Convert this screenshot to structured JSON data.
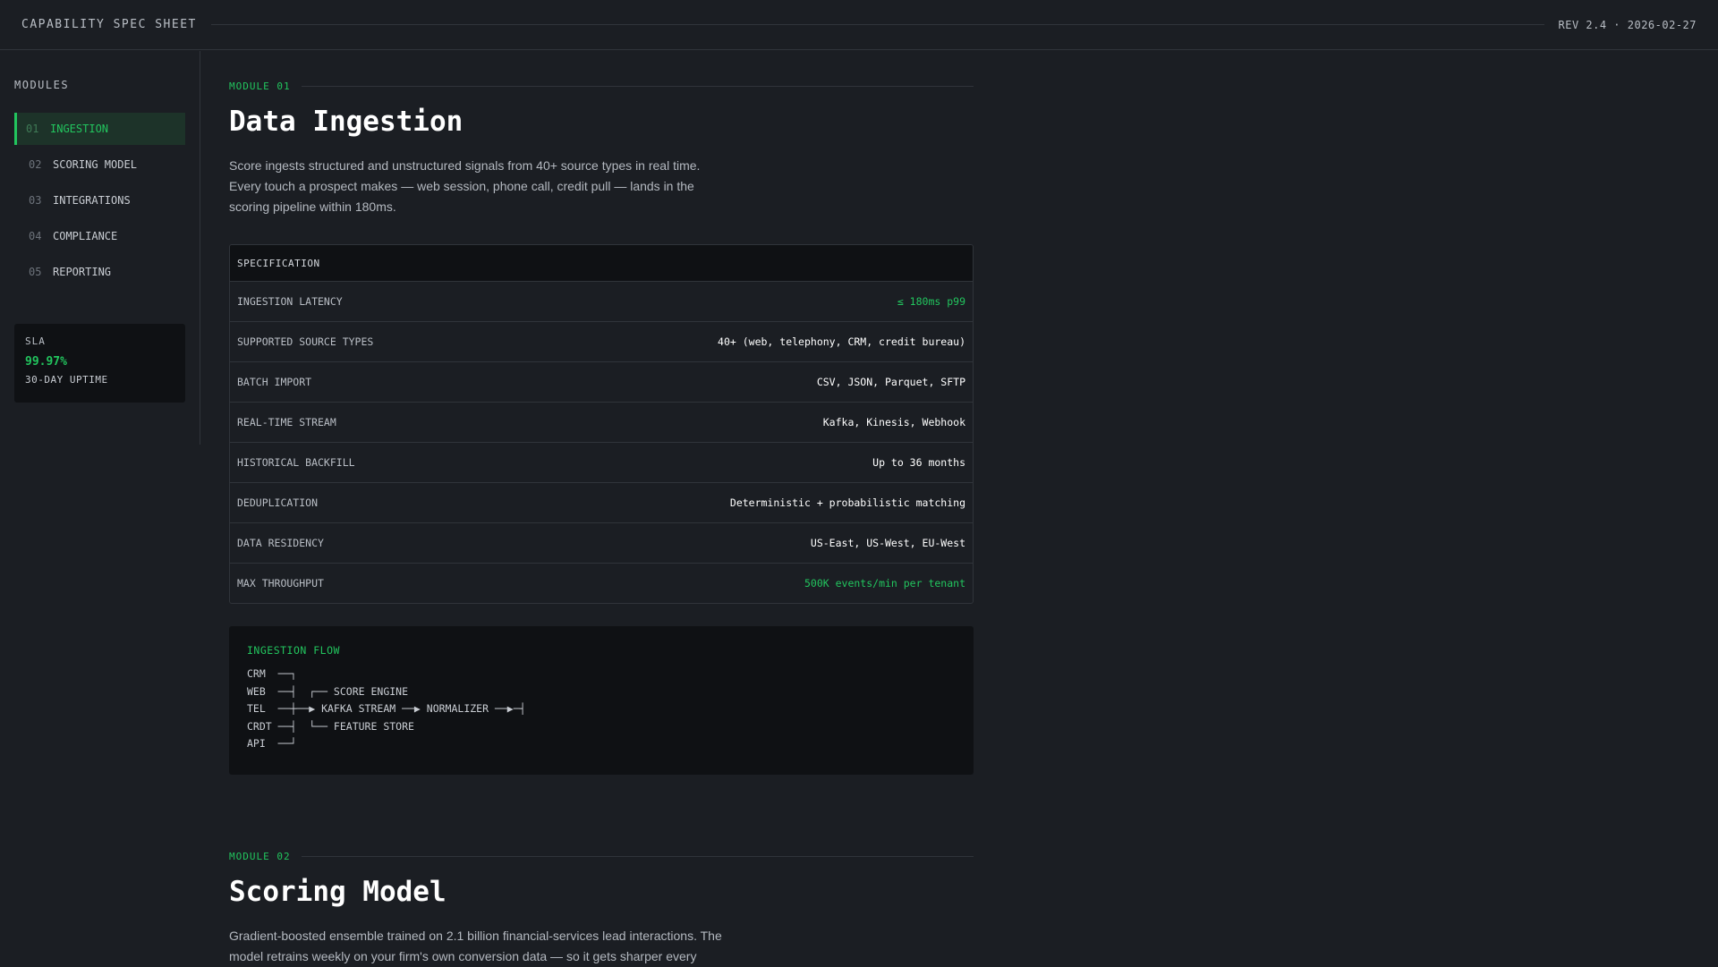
{
  "header": {
    "title": "CAPABILITY SPEC SHEET",
    "revision": "REV 2.4 · 2026-02-27"
  },
  "sidebar": {
    "heading": "MODULES",
    "items": [
      {
        "num": "01",
        "label": "INGESTION",
        "active": true
      },
      {
        "num": "02",
        "label": "SCORING MODEL",
        "active": false
      },
      {
        "num": "03",
        "label": "INTEGRATIONS",
        "active": false
      },
      {
        "num": "04",
        "label": "COMPLIANCE",
        "active": false
      },
      {
        "num": "05",
        "label": "REPORTING",
        "active": false
      }
    ],
    "sla": {
      "label": "SLA",
      "value": "99.97%",
      "sub": "30-DAY UPTIME"
    }
  },
  "module1": {
    "tag": "MODULE 01",
    "title": "Data Ingestion",
    "description": "Score ingests structured and unstructured signals from 40+ source types in real time. Every touch a prospect makes — web session, phone call, credit pull — lands in the scoring pipeline within 180ms.",
    "spec_header": "SPECIFICATION",
    "specs": [
      {
        "key": "INGESTION LATENCY",
        "value": "≤ 180ms p99",
        "highlight": true
      },
      {
        "key": "SUPPORTED SOURCE TYPES",
        "value": "40+ (web, telephony, CRM, credit bureau)",
        "highlight": false
      },
      {
        "key": "BATCH IMPORT",
        "value": "CSV, JSON, Parquet, SFTP",
        "highlight": false
      },
      {
        "key": "REAL-TIME STREAM",
        "value": "Kafka, Kinesis, Webhook",
        "highlight": false
      },
      {
        "key": "HISTORICAL BACKFILL",
        "value": "Up to 36 months",
        "highlight": false
      },
      {
        "key": "DEDUPLICATION",
        "value": "Deterministic + probabilistic matching",
        "highlight": false
      },
      {
        "key": "DATA RESIDENCY",
        "value": "US-East, US-West, EU-West",
        "highlight": false
      },
      {
        "key": "MAX THROUGHPUT",
        "value": "500K events/min per tenant",
        "highlight": true
      }
    ],
    "flow": {
      "title": "INGESTION FLOW",
      "diagram": "CRM  ──┐\nWEB  ──┤  ┌── SCORE ENGINE\nTEL  ──┼──▶ KAFKA STREAM ──▶ NORMALIZER ──▶─┤\nCRDT ──┤  └── FEATURE STORE\nAPI  ──┘"
    }
  },
  "module2": {
    "tag": "MODULE 02",
    "title": "Scoring Model",
    "description": "Gradient-boosted ensemble trained on 2.1 billion financial-services lead interactions. The model retrains weekly on your firm's own conversion data — so it gets sharper every"
  }
}
